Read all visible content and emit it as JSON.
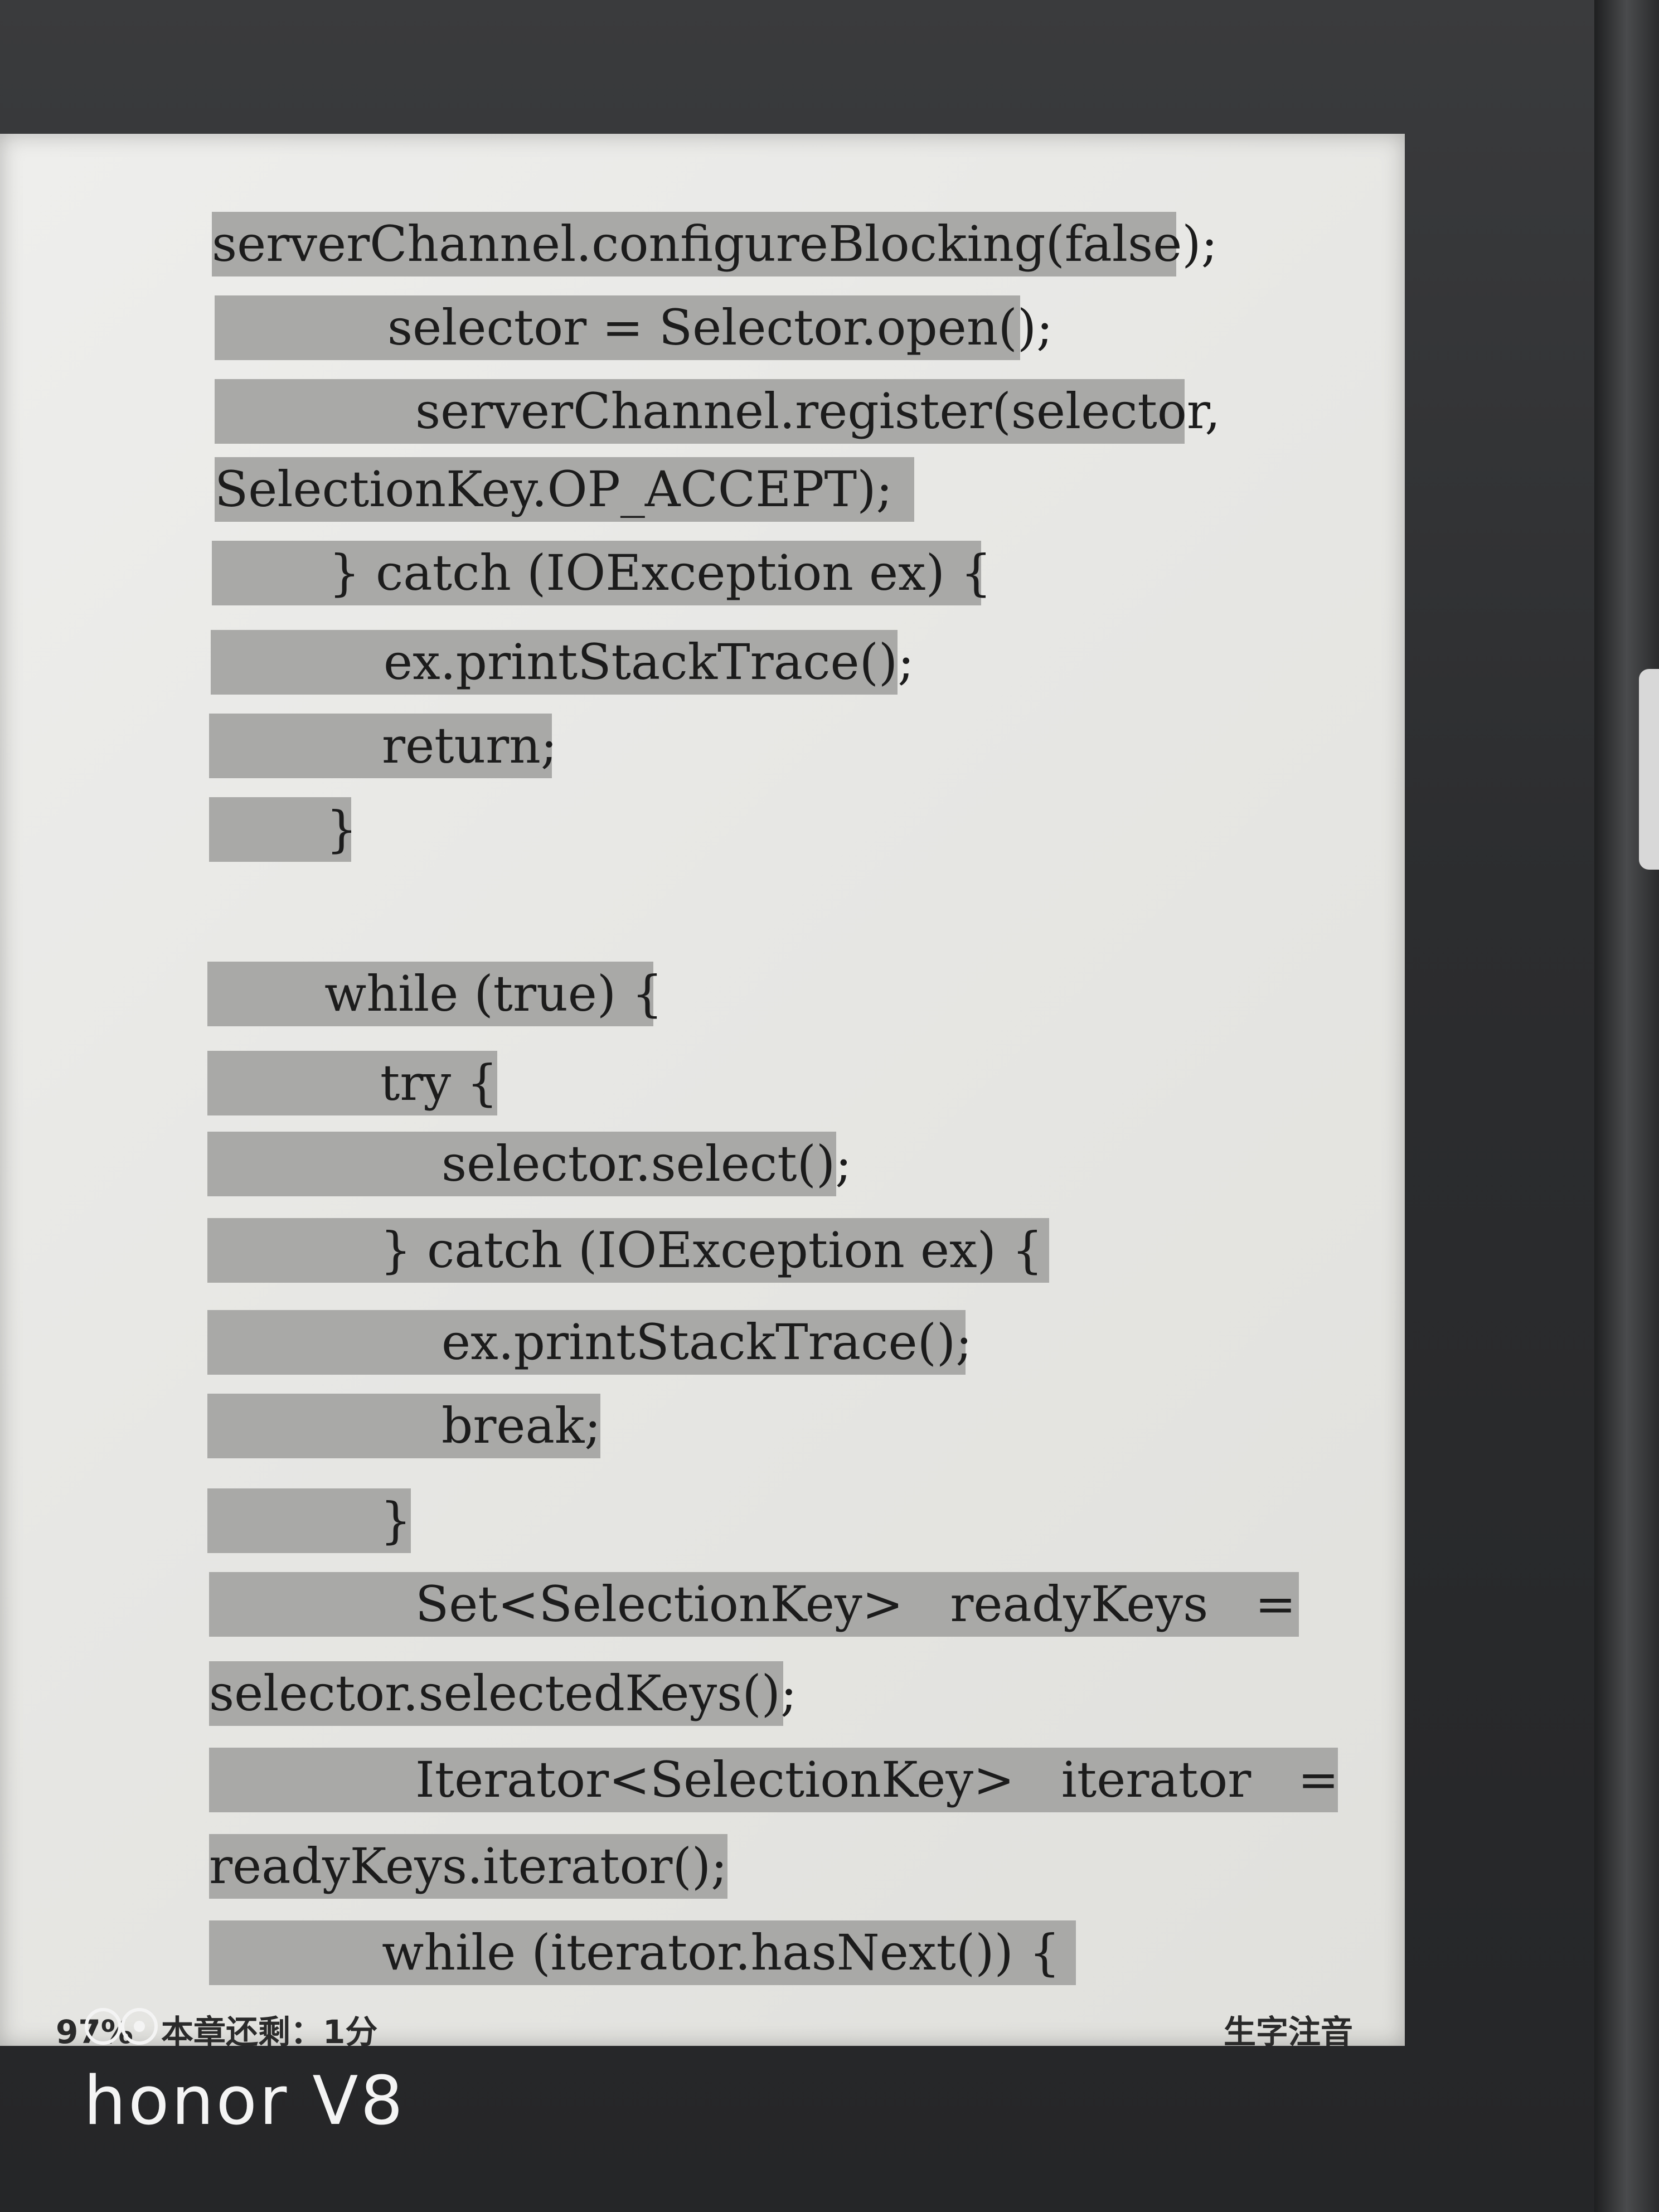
{
  "code_lines": [
    "serverChannel.configureBlocking(false);",
    "selector = Selector.open();",
    "serverChannel.register(selector,",
    "SelectionKey.OP_ACCEPT);",
    "} catch (IOException ex) {",
    "ex.printStackTrace();",
    "return;",
    "}",
    "while (true) {",
    "try {",
    "selector.select();",
    "} catch (IOException ex) {",
    "ex.printStackTrace();",
    "break;",
    "}",
    "Set<SelectionKey>   readyKeys   =",
    "selector.selectedKeys();",
    "Iterator<SelectionKey>   iterator   =",
    "readyKeys.iterator();",
    "while (iterator.hasNext()) {"
  ],
  "footer": {
    "progress": "97%",
    "chapter_remaining": "本章还剩：1分",
    "phonetic_button": "生字注音"
  },
  "watermark": {
    "brand": "honor V8"
  }
}
